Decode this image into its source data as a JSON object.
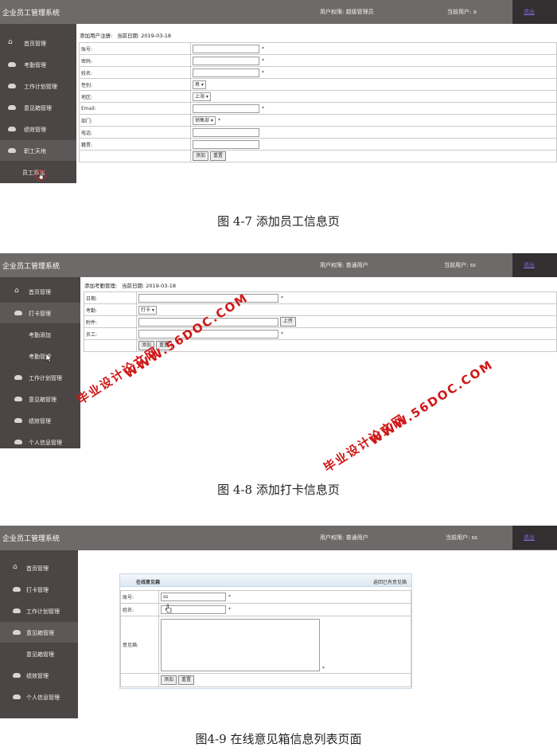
{
  "screens": [
    {
      "title": "企业员工管理系统",
      "permission": "用户权限: 超级管理员",
      "current_user": "当前用户: a",
      "logout": "退出",
      "nav": [
        {
          "label": "首页管理",
          "icon": "home-icon"
        },
        {
          "label": "考勤管理",
          "icon": "cloud-icon"
        },
        {
          "label": "工作计划管理",
          "icon": "cloud-icon"
        },
        {
          "label": "意见箱管理",
          "icon": "cloud-icon"
        },
        {
          "label": "绩效管理",
          "icon": "cloud-icon"
        },
        {
          "label": "职工天地",
          "icon": "cloud-icon"
        },
        {
          "label": "员工添加",
          "icon": ""
        }
      ],
      "form_title": "添加用户注册:",
      "date_text": "当前日期: 2019-03-18",
      "fields": [
        {
          "label": "账号:",
          "value": "",
          "required": "*"
        },
        {
          "label": "密码:",
          "value": "",
          "required": "*"
        },
        {
          "label": "姓名:",
          "value": "",
          "required": "*"
        },
        {
          "label": "性别:",
          "value": "男",
          "required": ""
        },
        {
          "label": "地区:",
          "value": "上海",
          "required": ""
        },
        {
          "label": "Email:",
          "value": "",
          "required": "*"
        },
        {
          "label": "部门:",
          "value": "销售部",
          "required": "*"
        },
        {
          "label": "电话:",
          "value": "",
          "required": ""
        },
        {
          "label": "籍贯:",
          "value": "",
          "required": ""
        }
      ],
      "buttons": [
        "添加",
        "重置"
      ],
      "caption": "图 4-7  添加员工信息页"
    },
    {
      "title": "企业员工管理系统",
      "permission": "用户权限: 普通用户",
      "current_user": "当前用户: ss",
      "logout": "退出",
      "nav": [
        {
          "label": "首页管理",
          "icon": "home-icon"
        },
        {
          "label": "打卡管理",
          "icon": "cloud-icon"
        },
        {
          "label": "考勤添加",
          "icon": ""
        },
        {
          "label": "考勤管理",
          "icon": ""
        },
        {
          "label": "工作计划管理",
          "icon": "cloud-icon"
        },
        {
          "label": "意见箱管理",
          "icon": "cloud-icon"
        },
        {
          "label": "绩效管理",
          "icon": "cloud-icon"
        },
        {
          "label": "个人信息管理",
          "icon": "cloud-icon"
        }
      ],
      "form_title": "添加考勤管理:",
      "date_text": "当前日期: 2019-03-18",
      "fields": [
        {
          "label": "日期:",
          "value": "",
          "required": "*"
        },
        {
          "label": "考勤:",
          "value": "打卡",
          "required": ""
        },
        {
          "label": "附件:",
          "value": "",
          "required": "",
          "extra": "上传"
        },
        {
          "label": "员工:",
          "value": "",
          "required": "*"
        }
      ],
      "buttons": [
        "添加",
        "重置"
      ],
      "caption": "图 4-8 添加打卡信息页"
    },
    {
      "title": "企业员工管理系统",
      "permission": "用户权限: 普通用户",
      "current_user": "当前用户: ss",
      "logout": "退出",
      "nav": [
        {
          "label": "首页管理",
          "icon": "home-icon"
        },
        {
          "label": "打卡管理",
          "icon": "cloud-icon"
        },
        {
          "label": "工作计划管理",
          "icon": "cloud-icon"
        },
        {
          "label": "意见箱管理",
          "icon": "cloud-icon"
        },
        {
          "label": "意见箱管理",
          "icon": ""
        },
        {
          "label": "绩效管理",
          "icon": "cloud-icon"
        },
        {
          "label": "个人信息管理",
          "icon": "cloud-icon"
        }
      ],
      "panel_title": "在线意见箱",
      "panel_link": "返回已有意见箱",
      "fields": [
        {
          "label": "账号:",
          "value": "ss",
          "required": "*"
        },
        {
          "label": "姓名:",
          "value": "",
          "required": "*"
        },
        {
          "label": "意见箱:",
          "value": "",
          "required": "*"
        }
      ],
      "buttons": [
        "添加",
        "重置"
      ],
      "caption": "图4-9  在线意见箱信息列表页面"
    }
  ],
  "watermarks": [
    "WWW.56DOC.COM",
    "毕业设计论文网",
    "WWW.56DOC.COM",
    "毕业设计论文网"
  ],
  "colors": {
    "topbar": "#6f6a6a",
    "sidebar": "#4c4545",
    "logout_box": "#332e2f",
    "watermark": "#d01818"
  }
}
